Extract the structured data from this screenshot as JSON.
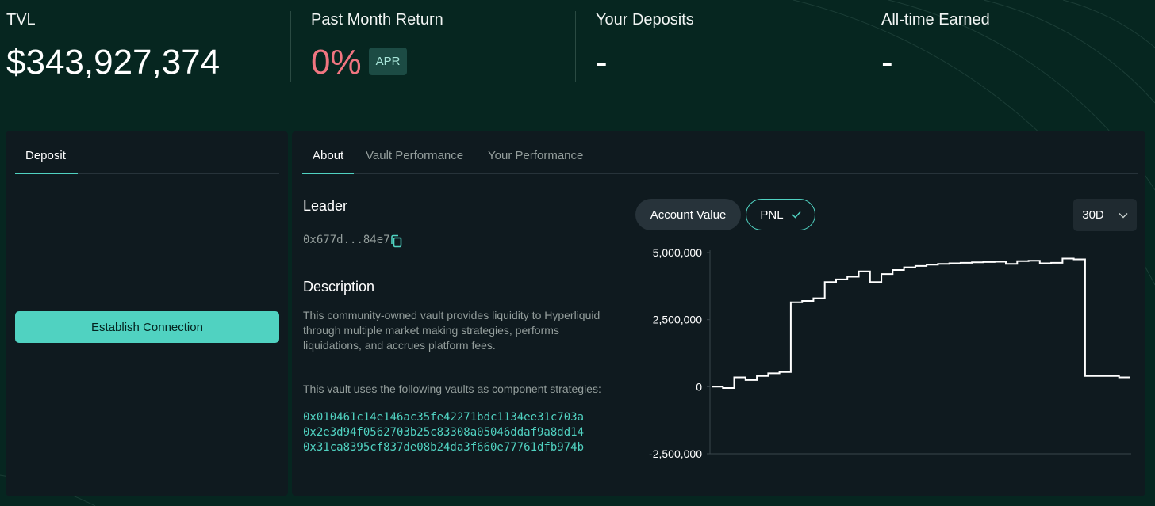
{
  "stats": {
    "tvl_label": "TVL",
    "tvl_value": "$343,927,374",
    "return_label": "Past Month Return",
    "return_value": "0%",
    "return_badge": "APR",
    "deposits_label": "Your Deposits",
    "deposits_value": "-",
    "earned_label": "All-time Earned",
    "earned_value": "-"
  },
  "deposit_panel": {
    "tab": "Deposit",
    "cta": "Establish Connection"
  },
  "info_panel": {
    "tabs": [
      "About",
      "Vault Performance",
      "Your Performance"
    ],
    "active_tab": "About",
    "leader_heading": "Leader",
    "leader_address": "0x677d...84e7",
    "description_heading": "Description",
    "description_text": "This community-owned vault provides liquidity to Hyperliquid through multiple market making strategies, performs liquidations, and accrues platform fees.",
    "component_intro": "This vault uses the following vaults as component strategies:",
    "component_vaults": [
      "0x010461c14e146ac35fe42271bdc1134ee31c703a",
      "0x2e3d94f0562703b25c83308a05046ddaf9a8dd14",
      "0x31ca8395cf837de08b24da3f660e77761dfb974b"
    ]
  },
  "chart_controls": {
    "account_value": "Account Value",
    "pnl": "PNL",
    "pnl_selected": true,
    "range": "30D"
  },
  "colors": {
    "background": "#062620",
    "panel": "#0f1a1f",
    "accent": "#50d2c1",
    "negative": "#f07580"
  },
  "chart_data": {
    "type": "line",
    "step": true,
    "series": [
      {
        "values": [
          0,
          -50000,
          350000,
          250000,
          400000,
          500000,
          550000,
          3150000,
          3200000,
          3300000,
          3900000,
          4000000,
          4100000,
          4300000,
          3900000,
          4200000,
          4350000,
          4450000,
          4500000,
          4550000,
          4580000,
          4600000,
          4620000,
          4640000,
          4650000,
          4660000,
          4580000,
          4680000,
          4700000,
          4600000,
          4620000,
          4780000,
          4750000,
          400000,
          400000,
          400000,
          350000
        ]
      }
    ],
    "ylim": [
      -2500000,
      5000000
    ],
    "yticks": [
      "5,000,000",
      "2,500,000",
      "0",
      "-2,500,000"
    ],
    "ytick_values": [
      5000000,
      2500000,
      0,
      -2500000
    ],
    "grid": false,
    "legend": "none"
  }
}
